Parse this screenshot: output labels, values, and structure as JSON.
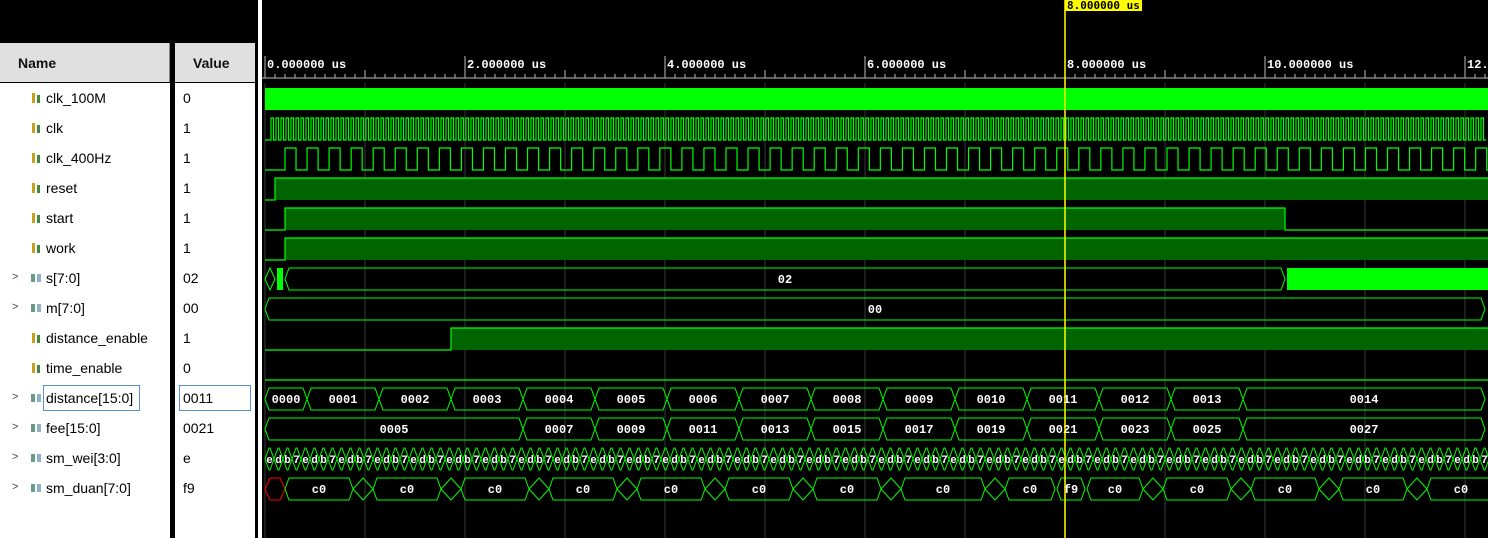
{
  "columns": {
    "name": "Name",
    "value": "Value"
  },
  "cursor": {
    "label": "8.000000 us",
    "time_us": 8.0
  },
  "timeline": {
    "start_us": 0,
    "end_us": 12.2,
    "major_ticks": [
      {
        "t": 0,
        "label": "0.000000 us"
      },
      {
        "t": 2,
        "label": "2.000000 us"
      },
      {
        "t": 4,
        "label": "4.000000 us"
      },
      {
        "t": 6,
        "label": "6.000000 us"
      },
      {
        "t": 8,
        "label": "8.000000 us"
      },
      {
        "t": 10,
        "label": "10.000000 us"
      },
      {
        "t": 12,
        "label": "12."
      }
    ]
  },
  "colors": {
    "wave": "#00ff00",
    "wave_fill": "#006400",
    "cursor": "#ffff00",
    "grid": "#3a3a3a",
    "unknown": "#ff0000"
  },
  "signals": [
    {
      "name": "clk_100M",
      "value": "0",
      "bus": false,
      "icon": "wire-icon"
    },
    {
      "name": "clk",
      "value": "1",
      "bus": false,
      "icon": "wire-icon"
    },
    {
      "name": "clk_400Hz",
      "value": "1",
      "bus": false,
      "icon": "wire-icon"
    },
    {
      "name": "reset",
      "value": "1",
      "bus": false,
      "icon": "wire-icon"
    },
    {
      "name": "start",
      "value": "1",
      "bus": false,
      "icon": "wire-icon"
    },
    {
      "name": "work",
      "value": "1",
      "bus": false,
      "icon": "wire-icon"
    },
    {
      "name": "s[7:0]",
      "value": "02",
      "bus": true,
      "icon": "bus-icon"
    },
    {
      "name": "m[7:0]",
      "value": "00",
      "bus": true,
      "icon": "bus-icon"
    },
    {
      "name": "distance_enable",
      "value": "1",
      "bus": false,
      "icon": "wire-icon"
    },
    {
      "name": "time_enable",
      "value": "0",
      "bus": false,
      "icon": "wire-icon"
    },
    {
      "name": "distance[15:0]",
      "value": "0011",
      "bus": true,
      "icon": "bus-icon",
      "selected": true
    },
    {
      "name": "fee[15:0]",
      "value": "0021",
      "bus": true,
      "icon": "bus-icon"
    },
    {
      "name": "sm_wei[3:0]",
      "value": "e",
      "bus": true,
      "icon": "bus-icon"
    },
    {
      "name": "sm_duan[7:0]",
      "value": "f9",
      "bus": true,
      "icon": "bus-icon"
    }
  ],
  "waves": {
    "s_segments": [
      {
        "label": "02",
        "from_us": 0.2,
        "to_us": 10.2
      }
    ],
    "m_segments": [
      {
        "label": "00",
        "from_us": 0.0,
        "to_us": 12.2
      }
    ],
    "distance_segments": [
      {
        "label": "0000",
        "from_us": 0.0,
        "to_us": 0.42
      },
      {
        "label": "0001",
        "from_us": 0.42,
        "to_us": 1.14
      },
      {
        "label": "0002",
        "from_us": 1.14,
        "to_us": 1.86
      },
      {
        "label": "0003",
        "from_us": 1.86,
        "to_us": 2.58
      },
      {
        "label": "0004",
        "from_us": 2.58,
        "to_us": 3.3
      },
      {
        "label": "0005",
        "from_us": 3.3,
        "to_us": 4.02
      },
      {
        "label": "0006",
        "from_us": 4.02,
        "to_us": 4.74
      },
      {
        "label": "0007",
        "from_us": 4.74,
        "to_us": 5.46
      },
      {
        "label": "0008",
        "from_us": 5.46,
        "to_us": 6.18
      },
      {
        "label": "0009",
        "from_us": 6.18,
        "to_us": 6.9
      },
      {
        "label": "0010",
        "from_us": 6.9,
        "to_us": 7.62
      },
      {
        "label": "0011",
        "from_us": 7.62,
        "to_us": 8.34
      },
      {
        "label": "0012",
        "from_us": 8.34,
        "to_us": 9.06
      },
      {
        "label": "0013",
        "from_us": 9.06,
        "to_us": 9.78
      },
      {
        "label": "0014",
        "from_us": 9.78,
        "to_us": 12.2
      }
    ],
    "fee_segments": [
      {
        "label": "0005",
        "from_us": 0.0,
        "to_us": 2.58
      },
      {
        "label": "0007",
        "from_us": 2.58,
        "to_us": 3.3
      },
      {
        "label": "0009",
        "from_us": 3.3,
        "to_us": 4.02
      },
      {
        "label": "0011",
        "from_us": 4.02,
        "to_us": 4.74
      },
      {
        "label": "0013",
        "from_us": 4.74,
        "to_us": 5.46
      },
      {
        "label": "0015",
        "from_us": 5.46,
        "to_us": 6.18
      },
      {
        "label": "0017",
        "from_us": 6.18,
        "to_us": 6.9
      },
      {
        "label": "0019",
        "from_us": 6.9,
        "to_us": 7.62
      },
      {
        "label": "0021",
        "from_us": 7.62,
        "to_us": 8.34
      },
      {
        "label": "0023",
        "from_us": 8.34,
        "to_us": 9.06
      },
      {
        "label": "0025",
        "from_us": 9.06,
        "to_us": 9.78
      },
      {
        "label": "0027",
        "from_us": 9.78,
        "to_us": 12.2
      }
    ],
    "sm_wei_cycle": [
      "e",
      "d",
      "b",
      "7"
    ],
    "sm_wei_step_us": 0.09,
    "sm_duan_segments": [
      {
        "label": "c0",
        "from_us": 0.2,
        "to_us": 0.88
      },
      {
        "label": "c0",
        "from_us": 1.08,
        "to_us": 1.76
      },
      {
        "label": "c0",
        "from_us": 1.96,
        "to_us": 2.64
      },
      {
        "label": "c0",
        "from_us": 2.84,
        "to_us": 3.52
      },
      {
        "label": "c0",
        "from_us": 3.72,
        "to_us": 4.4
      },
      {
        "label": "c0",
        "from_us": 4.6,
        "to_us": 5.28
      },
      {
        "label": "c0",
        "from_us": 5.48,
        "to_us": 6.16
      },
      {
        "label": "c0",
        "from_us": 6.36,
        "to_us": 7.2
      },
      {
        "label": "c0",
        "from_us": 7.4,
        "to_us": 7.9
      },
      {
        "label": "f9",
        "from_us": 7.92,
        "to_us": 8.2
      },
      {
        "label": "c0",
        "from_us": 8.22,
        "to_us": 8.78
      },
      {
        "label": "c0",
        "from_us": 8.98,
        "to_us": 9.66
      },
      {
        "label": "c0",
        "from_us": 9.86,
        "to_us": 10.54
      },
      {
        "label": "c0",
        "from_us": 10.74,
        "to_us": 11.42
      },
      {
        "label": "c0",
        "from_us": 11.62,
        "to_us": 12.3
      }
    ]
  }
}
